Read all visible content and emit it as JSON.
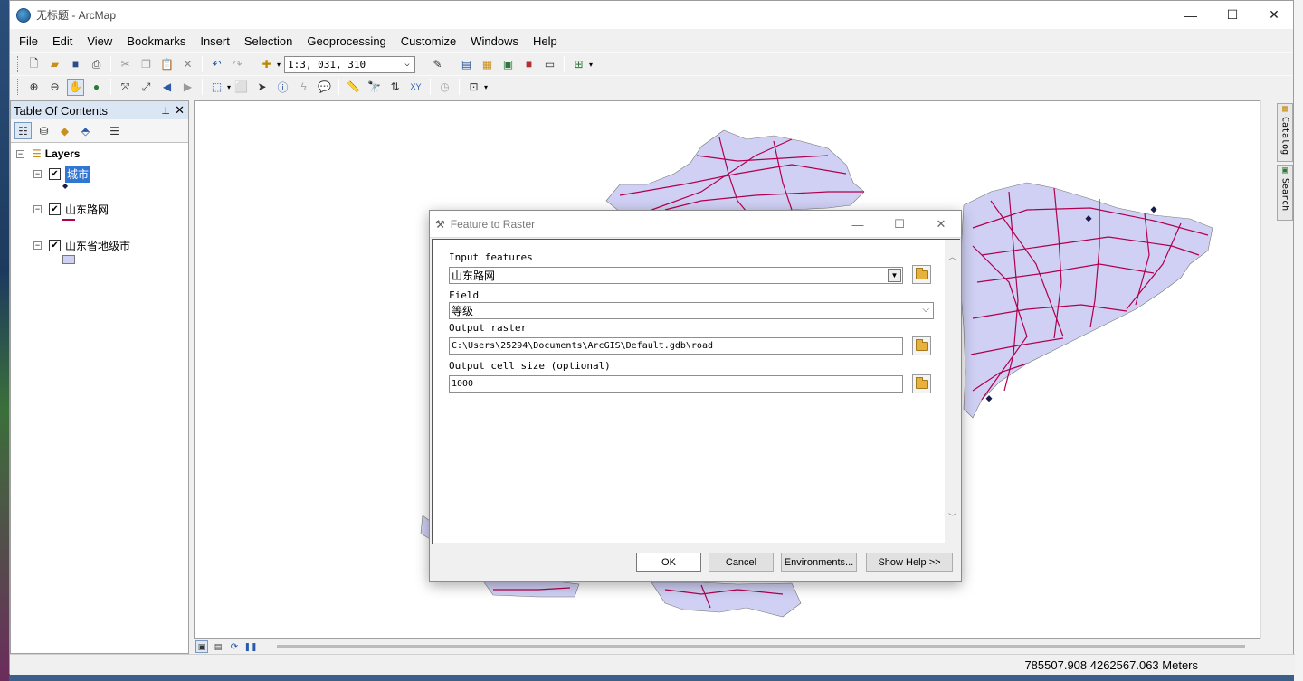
{
  "window": {
    "title": "无标题 - ArcMap",
    "minimize": "—",
    "maximize": "☐",
    "close": "✕"
  },
  "menu": [
    "File",
    "Edit",
    "View",
    "Bookmarks",
    "Insert",
    "Selection",
    "Geoprocessing",
    "Customize",
    "Windows",
    "Help"
  ],
  "toolbar": {
    "scale_value": "1:3, 031, 310"
  },
  "toc": {
    "title": "Table Of Contents",
    "pin": "⊥",
    "close": "✕",
    "root": "Layers",
    "layers": [
      {
        "name": "城市",
        "checked": true,
        "selected": true,
        "symbol": "point"
      },
      {
        "name": "山东路网",
        "checked": true,
        "selected": false,
        "symbol": "line"
      },
      {
        "name": "山东省地级市",
        "checked": true,
        "selected": false,
        "symbol": "polygon"
      }
    ]
  },
  "colors": {
    "road": "#b0004e",
    "polygon": "#d0d0f4",
    "selection": "#3176d3"
  },
  "dock": {
    "catalog": "Catalog",
    "search": "Search"
  },
  "status": {
    "coords": "785507.908  4262567.063 Meters"
  },
  "dialog": {
    "title": "Feature to Raster",
    "input_features_label": "Input features",
    "input_features_value": "山东路网",
    "field_label": "Field",
    "field_value": "等级",
    "output_raster_label": "Output raster",
    "output_raster_value": "C:\\Users\\25294\\Documents\\ArcGIS\\Default.gdb\\road",
    "cell_size_label": "Output cell size (optional)",
    "cell_size_value": "1000",
    "buttons": {
      "ok": "OK",
      "cancel": "Cancel",
      "environments": "Environments...",
      "show_help": "Show Help >>"
    }
  }
}
